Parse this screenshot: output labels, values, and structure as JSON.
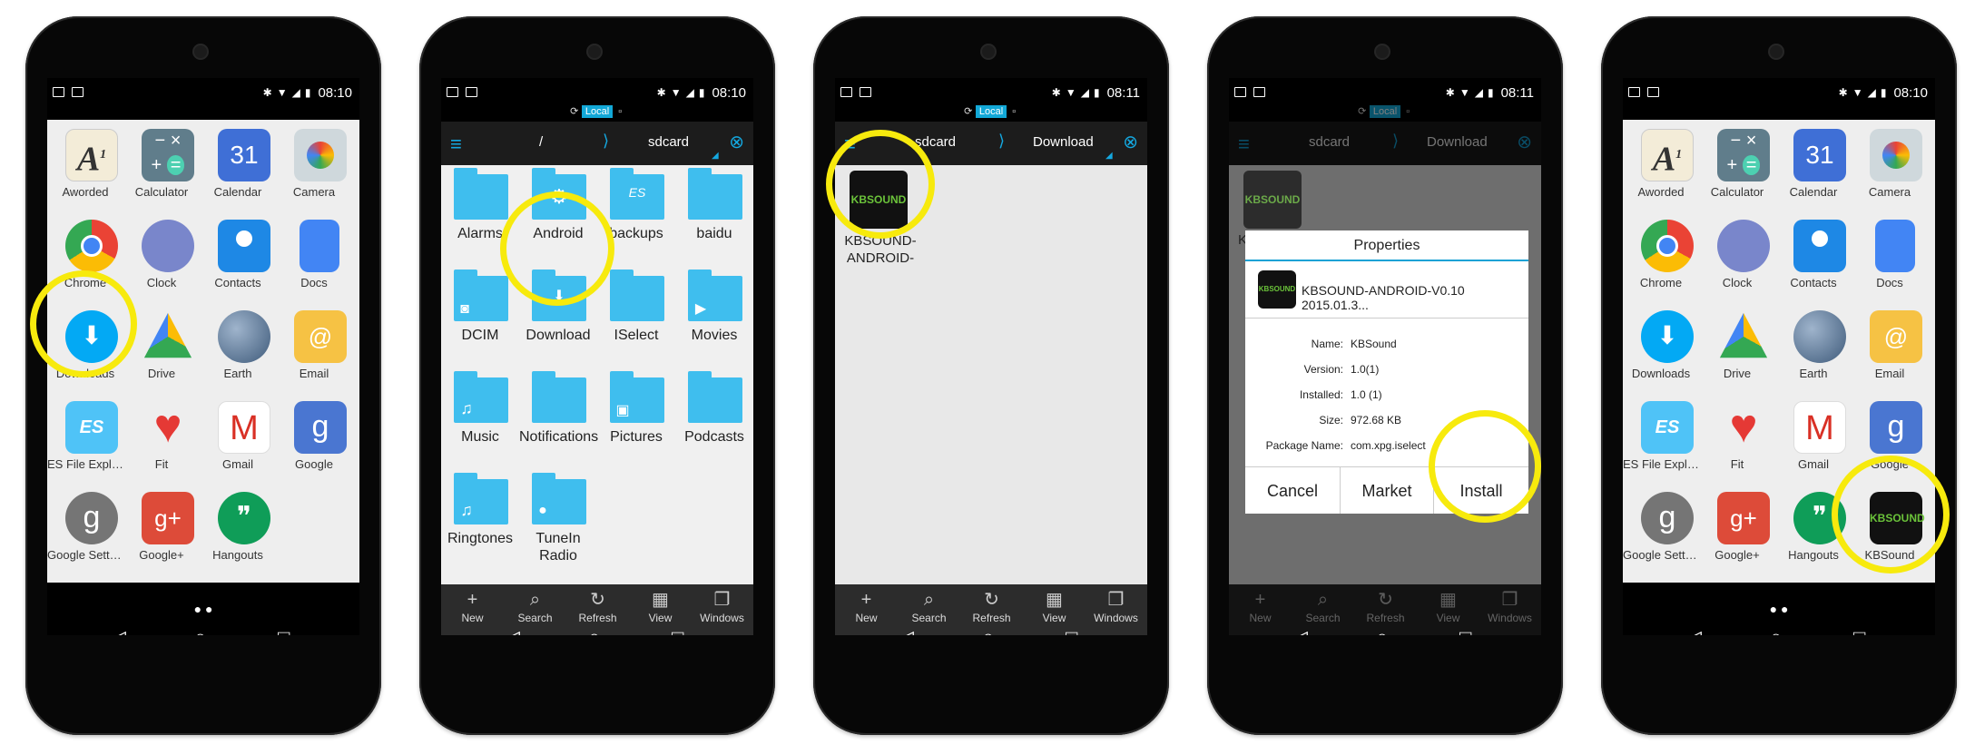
{
  "phones": [
    {
      "time": "08:10"
    },
    {
      "time": "08:10",
      "location": "Local",
      "path_root": "/",
      "path_current": "sdcard"
    },
    {
      "time": "08:11",
      "location": "Local",
      "path_root": "sdcard",
      "path_current": "Download"
    },
    {
      "time": "08:11",
      "location": "Local",
      "path_root": "sdcard",
      "path_current": "Download"
    },
    {
      "time": "08:10"
    }
  ],
  "launcher_apps": [
    "Aworded",
    "Calculator",
    "Calendar",
    "Camera",
    "Chrome",
    "Clock",
    "Contacts",
    "Docs",
    "Downloads",
    "Drive",
    "Earth",
    "Email",
    "ES File Explor..",
    "Fit",
    "Gmail",
    "Google",
    "Google Settin..",
    "Google+",
    "Hangouts"
  ],
  "installed_app": "KBSound",
  "calendar_day": "31",
  "aworded_badge": "1",
  "folders": [
    "Alarms",
    "Android",
    "backups",
    "baidu",
    "DCIM",
    "Download",
    "ISelect",
    "Movies",
    "Music",
    "Notifications",
    "Pictures",
    "Podcasts",
    "Ringtones",
    "TuneIn Radio"
  ],
  "toolbar": [
    "New",
    "Search",
    "Refresh",
    "View",
    "Windows"
  ],
  "download_file": "KBSOUND-ANDROID-",
  "download_file_short": "K",
  "kb_logo": "KBSOUND",
  "dialog": {
    "title": "Properties",
    "filename": "KBSOUND-ANDROID-V0.10 2015.01.3...",
    "name_label": "Name:",
    "name": "KBSound",
    "version_label": "Version:",
    "version": "1.0(1)",
    "installed_label": "Installed:",
    "installed": "1.0 (1)",
    "size_label": "Size:",
    "size": "972.68 KB",
    "package_label": "Package Name:",
    "package": "com.xpg.iselect",
    "cancel": "Cancel",
    "market": "Market",
    "install": "Install"
  },
  "colors": {
    "accent": "#14a8e0",
    "folder": "#3fbeee",
    "highlight": "#f7ea0d"
  }
}
